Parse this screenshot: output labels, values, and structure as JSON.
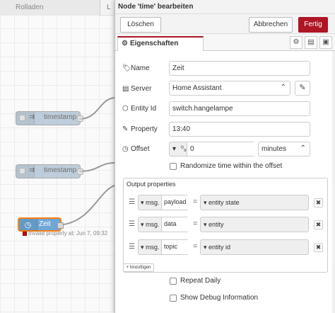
{
  "canvas": {
    "tab_label": "Rolladen",
    "tab2_label": "L",
    "nodes": [
      {
        "label": "timestamp"
      },
      {
        "label": "timestamp"
      },
      {
        "label": "Zeit",
        "status": "Invalid property at: Jun 7, 09:32"
      }
    ]
  },
  "tray": {
    "title": "Node 'time' bearbeiten",
    "delete_label": "Löschen",
    "cancel_label": "Abbrechen",
    "done_label": "Fertig",
    "properties_tab": "Eigenschaften",
    "fields": {
      "name": {
        "label": "Name",
        "value": "Zeit"
      },
      "server": {
        "label": "Server",
        "value": "Home Assistant"
      },
      "entity_id": {
        "label": "Entity Id",
        "value": "switch.hangelampe"
      },
      "property": {
        "label": "Property",
        "value": "13:40"
      },
      "offset": {
        "label": "Offset",
        "value": "0",
        "unit": "minutes"
      }
    },
    "randomize_label": "Randomize time within the offset",
    "output_properties": {
      "title": "Output properties",
      "rows": [
        {
          "prefix": "msg.",
          "field": "payload",
          "value": "entity state"
        },
        {
          "prefix": "msg.",
          "field": "data",
          "value": "entity"
        },
        {
          "prefix": "msg.",
          "field": "topic",
          "value": "entity id"
        }
      ],
      "add_label": "+ hinzufügen"
    },
    "repeat_daily_label": "Repeat Daily",
    "show_debug_label": "Show Debug Information"
  },
  "colors": {
    "accent": "#ad1625",
    "node_timestamp": "#a6bbcf",
    "node_selected_border": "#ff7f0e"
  }
}
